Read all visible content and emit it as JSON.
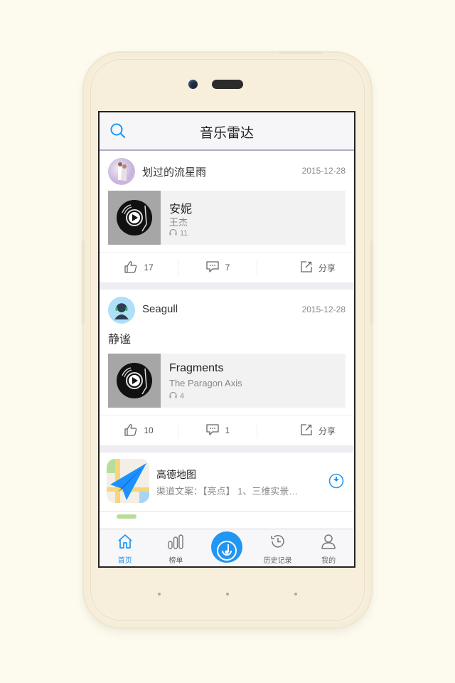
{
  "header": {
    "title": "音乐雷达",
    "search_icon": "search-icon"
  },
  "posts": [
    {
      "user": "划过的流星雨",
      "date": "2015-12-28",
      "text": "",
      "song": {
        "title": "安妮",
        "artist": "王杰",
        "plays": "11"
      },
      "likes": "17",
      "comments": "7",
      "share_label": "分享"
    },
    {
      "user": "Seagull",
      "date": "2015-12-28",
      "text": "静谧",
      "song": {
        "title": "Fragments",
        "artist": "The Paragon Axis",
        "plays": "4"
      },
      "likes": "10",
      "comments": "1",
      "share_label": "分享"
    }
  ],
  "app_promo": {
    "name": "高德地图",
    "desc": "渠道文案：【亮点】 1、三维实景…"
  },
  "tabbar": {
    "items": [
      {
        "label": "首页",
        "icon": "home-icon",
        "active": true
      },
      {
        "label": "榜单",
        "icon": "chart-icon",
        "active": false
      },
      {
        "label": "",
        "icon": "radar-icon",
        "active": false
      },
      {
        "label": "历史记录",
        "icon": "history-icon",
        "active": false
      },
      {
        "label": "我的",
        "icon": "user-icon",
        "active": false
      }
    ]
  },
  "colors": {
    "accent": "#2196f3",
    "separator": "#ededf3",
    "phone_body": "#f7efdc"
  }
}
